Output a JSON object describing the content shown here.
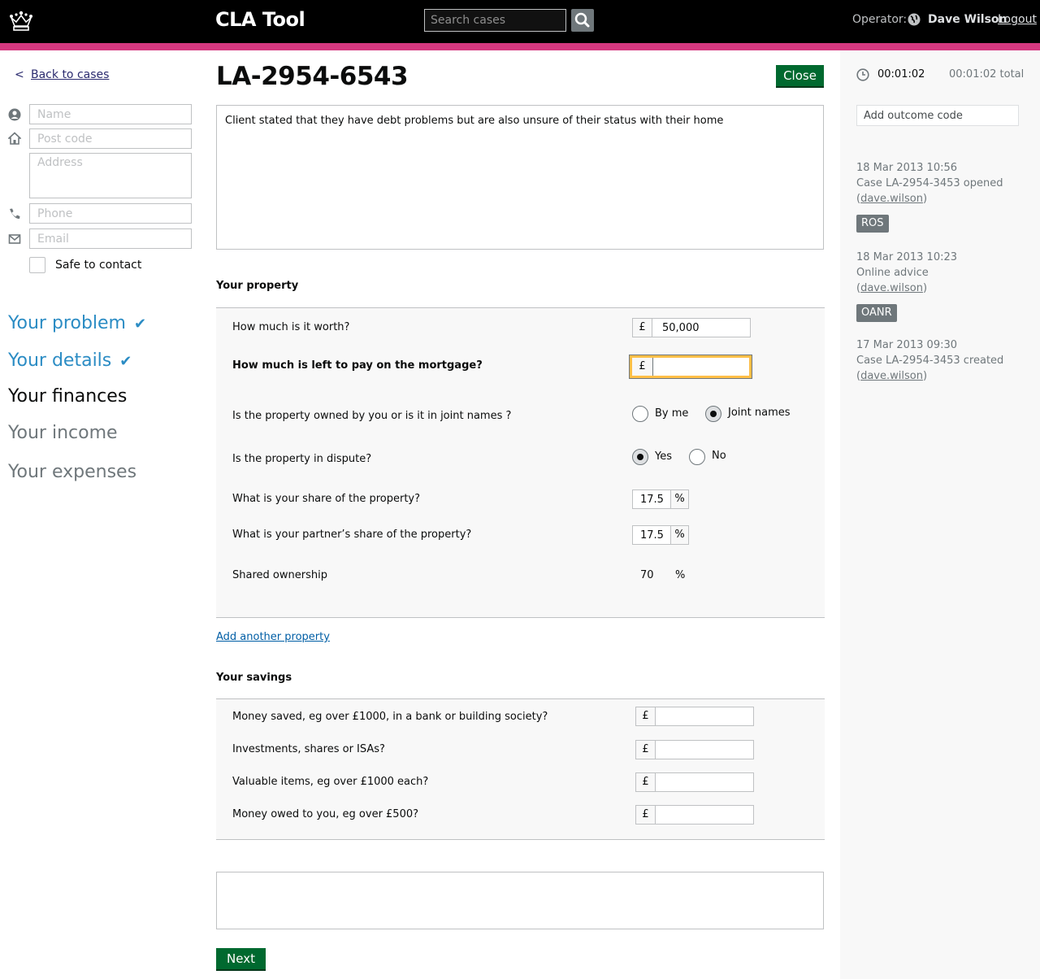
{
  "header": {
    "app_title": "CLA Tool",
    "search_placeholder": "Search cases",
    "operator_label": "Operator:",
    "operator_name": "Dave Wilson",
    "logout_label": "Logout"
  },
  "sidebar": {
    "back_label": "Back to cases",
    "fields": {
      "name_placeholder": "Name",
      "postcode_placeholder": "Post code",
      "address_placeholder": "Address",
      "phone_placeholder": "Phone",
      "email_placeholder": "Email"
    },
    "safe_to_contact_label": "Safe to contact",
    "steps": [
      {
        "label": "Your problem",
        "state": "done"
      },
      {
        "label": "Your details",
        "state": "done"
      },
      {
        "label": "Your finances",
        "state": "current"
      },
      {
        "label": "Your income",
        "state": "todo"
      },
      {
        "label": "Your expenses",
        "state": "todo"
      }
    ]
  },
  "main": {
    "case_ref": "LA-2954-6543",
    "close_label": "Close",
    "notes": "Client stated that they have debt problems but are also unsure of their status with their home",
    "property": {
      "heading": "Your property",
      "worth_question": "How much is it worth?",
      "worth_currency": "£",
      "worth_value": "50,000",
      "mortgage_question": "How much is left to pay on the mortgage?",
      "mortgage_currency": "£",
      "mortgage_value": "",
      "owned_question": "Is the property owned by you or is it in joint names ?",
      "owned_options": [
        "By me",
        "Joint names"
      ],
      "owned_selected": "Joint names",
      "dispute_question": "Is the property in dispute?",
      "dispute_options": [
        "Yes",
        "No"
      ],
      "dispute_selected": "Yes",
      "share_question": "What is your share of the property?",
      "share_value": "17.5",
      "partner_share_question": "What is your partner’s share of the property?",
      "partner_share_value": "17.5",
      "percent_sign": "%",
      "shared_ownership_label": "Shared ownership",
      "shared_ownership_value": "70",
      "add_property_label": "Add another property"
    },
    "savings": {
      "heading": "Your savings",
      "currency": "£",
      "items": [
        {
          "question": "Money saved, eg over £1000, in a bank or building society?",
          "value": ""
        },
        {
          "question": "Investments, shares or ISAs?",
          "value": ""
        },
        {
          "question": "Valuable items, eg over £1000 each?",
          "value": ""
        },
        {
          "question": "Money owed to you, eg over £500?",
          "value": ""
        }
      ]
    },
    "next_label": "Next"
  },
  "right": {
    "timer_current": "00:01:02",
    "timer_total": "00:01:02 total",
    "outcome_placeholder": "Add outcome code",
    "log": [
      {
        "time": "18 Mar 2013 10:56",
        "text": "Case LA-2954-3453 opened",
        "user": "dave.wilson",
        "badge": "ROS"
      },
      {
        "time": "18 Mar 2013 10:23",
        "text": "Online advice",
        "user": "dave.wilson",
        "badge": "OANR"
      },
      {
        "time": "17 Mar 2013 09:30",
        "text": "Case LA-2954-3453 created",
        "user": "dave.wilson",
        "badge": ""
      }
    ]
  },
  "colors": {
    "header_bg": "#000000",
    "accent_bar": "#d53880",
    "button_green": "#00692f",
    "link_blue": "#005ea5",
    "step_done": "#2b8cc4",
    "focus_yellow": "#ffbf47"
  },
  "icons": [
    "crown-logo-icon",
    "search-icon",
    "globe-icon",
    "chevron-left-icon",
    "person-icon",
    "home-icon",
    "phone-icon",
    "envelope-icon",
    "check-icon",
    "clock-icon"
  ]
}
